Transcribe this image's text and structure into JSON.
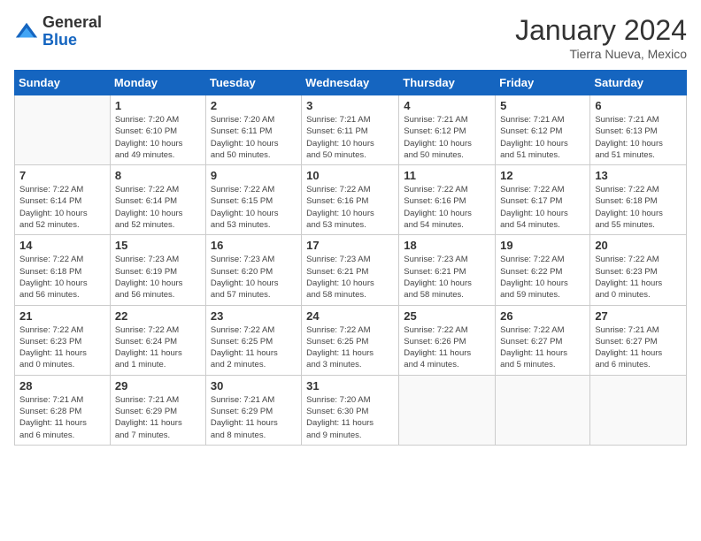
{
  "logo": {
    "general": "General",
    "blue": "Blue"
  },
  "title": {
    "month_year": "January 2024",
    "location": "Tierra Nueva, Mexico"
  },
  "headers": [
    "Sunday",
    "Monday",
    "Tuesday",
    "Wednesday",
    "Thursday",
    "Friday",
    "Saturday"
  ],
  "weeks": [
    [
      {
        "day": "",
        "info": ""
      },
      {
        "day": "1",
        "info": "Sunrise: 7:20 AM\nSunset: 6:10 PM\nDaylight: 10 hours\nand 49 minutes."
      },
      {
        "day": "2",
        "info": "Sunrise: 7:20 AM\nSunset: 6:11 PM\nDaylight: 10 hours\nand 50 minutes."
      },
      {
        "day": "3",
        "info": "Sunrise: 7:21 AM\nSunset: 6:11 PM\nDaylight: 10 hours\nand 50 minutes."
      },
      {
        "day": "4",
        "info": "Sunrise: 7:21 AM\nSunset: 6:12 PM\nDaylight: 10 hours\nand 50 minutes."
      },
      {
        "day": "5",
        "info": "Sunrise: 7:21 AM\nSunset: 6:12 PM\nDaylight: 10 hours\nand 51 minutes."
      },
      {
        "day": "6",
        "info": "Sunrise: 7:21 AM\nSunset: 6:13 PM\nDaylight: 10 hours\nand 51 minutes."
      }
    ],
    [
      {
        "day": "7",
        "info": "Sunrise: 7:22 AM\nSunset: 6:14 PM\nDaylight: 10 hours\nand 52 minutes."
      },
      {
        "day": "8",
        "info": "Sunrise: 7:22 AM\nSunset: 6:14 PM\nDaylight: 10 hours\nand 52 minutes."
      },
      {
        "day": "9",
        "info": "Sunrise: 7:22 AM\nSunset: 6:15 PM\nDaylight: 10 hours\nand 53 minutes."
      },
      {
        "day": "10",
        "info": "Sunrise: 7:22 AM\nSunset: 6:16 PM\nDaylight: 10 hours\nand 53 minutes."
      },
      {
        "day": "11",
        "info": "Sunrise: 7:22 AM\nSunset: 6:16 PM\nDaylight: 10 hours\nand 54 minutes."
      },
      {
        "day": "12",
        "info": "Sunrise: 7:22 AM\nSunset: 6:17 PM\nDaylight: 10 hours\nand 54 minutes."
      },
      {
        "day": "13",
        "info": "Sunrise: 7:22 AM\nSunset: 6:18 PM\nDaylight: 10 hours\nand 55 minutes."
      }
    ],
    [
      {
        "day": "14",
        "info": "Sunrise: 7:22 AM\nSunset: 6:18 PM\nDaylight: 10 hours\nand 56 minutes."
      },
      {
        "day": "15",
        "info": "Sunrise: 7:23 AM\nSunset: 6:19 PM\nDaylight: 10 hours\nand 56 minutes."
      },
      {
        "day": "16",
        "info": "Sunrise: 7:23 AM\nSunset: 6:20 PM\nDaylight: 10 hours\nand 57 minutes."
      },
      {
        "day": "17",
        "info": "Sunrise: 7:23 AM\nSunset: 6:21 PM\nDaylight: 10 hours\nand 58 minutes."
      },
      {
        "day": "18",
        "info": "Sunrise: 7:23 AM\nSunset: 6:21 PM\nDaylight: 10 hours\nand 58 minutes."
      },
      {
        "day": "19",
        "info": "Sunrise: 7:22 AM\nSunset: 6:22 PM\nDaylight: 10 hours\nand 59 minutes."
      },
      {
        "day": "20",
        "info": "Sunrise: 7:22 AM\nSunset: 6:23 PM\nDaylight: 11 hours\nand 0 minutes."
      }
    ],
    [
      {
        "day": "21",
        "info": "Sunrise: 7:22 AM\nSunset: 6:23 PM\nDaylight: 11 hours\nand 0 minutes."
      },
      {
        "day": "22",
        "info": "Sunrise: 7:22 AM\nSunset: 6:24 PM\nDaylight: 11 hours\nand 1 minute."
      },
      {
        "day": "23",
        "info": "Sunrise: 7:22 AM\nSunset: 6:25 PM\nDaylight: 11 hours\nand 2 minutes."
      },
      {
        "day": "24",
        "info": "Sunrise: 7:22 AM\nSunset: 6:25 PM\nDaylight: 11 hours\nand 3 minutes."
      },
      {
        "day": "25",
        "info": "Sunrise: 7:22 AM\nSunset: 6:26 PM\nDaylight: 11 hours\nand 4 minutes."
      },
      {
        "day": "26",
        "info": "Sunrise: 7:22 AM\nSunset: 6:27 PM\nDaylight: 11 hours\nand 5 minutes."
      },
      {
        "day": "27",
        "info": "Sunrise: 7:21 AM\nSunset: 6:27 PM\nDaylight: 11 hours\nand 6 minutes."
      }
    ],
    [
      {
        "day": "28",
        "info": "Sunrise: 7:21 AM\nSunset: 6:28 PM\nDaylight: 11 hours\nand 6 minutes."
      },
      {
        "day": "29",
        "info": "Sunrise: 7:21 AM\nSunset: 6:29 PM\nDaylight: 11 hours\nand 7 minutes."
      },
      {
        "day": "30",
        "info": "Sunrise: 7:21 AM\nSunset: 6:29 PM\nDaylight: 11 hours\nand 8 minutes."
      },
      {
        "day": "31",
        "info": "Sunrise: 7:20 AM\nSunset: 6:30 PM\nDaylight: 11 hours\nand 9 minutes."
      },
      {
        "day": "",
        "info": ""
      },
      {
        "day": "",
        "info": ""
      },
      {
        "day": "",
        "info": ""
      }
    ]
  ]
}
